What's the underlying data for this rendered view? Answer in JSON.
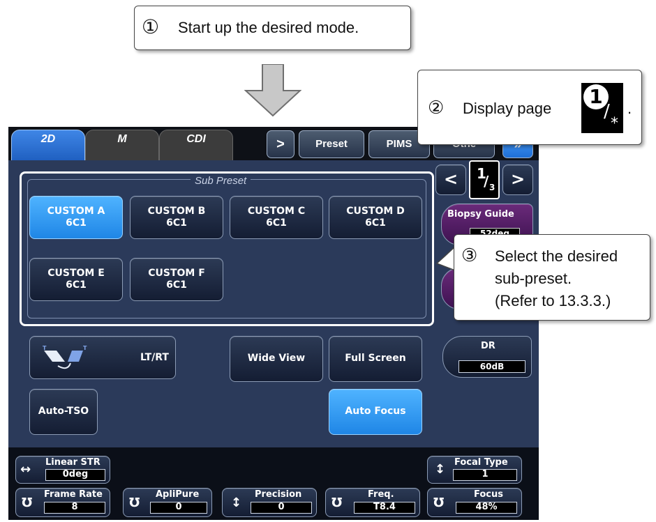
{
  "callouts": {
    "step1_num": "①",
    "step1_text": "Start up the desired mode.",
    "step2_num": "②",
    "step2_text": "Display page",
    "step2_period": ".",
    "step2_page_icon_num": "1",
    "step2_page_icon_sub": "*",
    "step3_num": "③",
    "step3_line1": "Select the desired",
    "step3_line2": "sub-preset.",
    "step3_line3": "(Refer to 13.3.3.)"
  },
  "tabs": [
    {
      "label": "2D",
      "active": true
    },
    {
      "label": "M",
      "active": false
    },
    {
      "label": "CDI",
      "active": false
    }
  ],
  "top_buttons": {
    "next_arrow": ">",
    "preset": "Preset",
    "pims": "PIMS",
    "other": "Othe",
    "more": "»"
  },
  "pager": {
    "prev": "<",
    "page": "1",
    "total": "3",
    "next": ">"
  },
  "sub_preset": {
    "title": "Sub Preset",
    "buttons": [
      {
        "name": "CUSTOM A",
        "probe": "6C1",
        "selected": true
      },
      {
        "name": "CUSTOM B",
        "probe": "6C1",
        "selected": false
      },
      {
        "name": "CUSTOM C",
        "probe": "6C1",
        "selected": false
      },
      {
        "name": "CUSTOM D",
        "probe": "6C1",
        "selected": false
      },
      {
        "name": "CUSTOM E",
        "probe": "6C1",
        "selected": false
      },
      {
        "name": "CUSTOM F",
        "probe": "6C1",
        "selected": false
      }
    ]
  },
  "side": {
    "biopsy_label": "Biopsy Guide",
    "biopsy_value": "52deg",
    "dr_label": "DR",
    "dr_value": "60dB"
  },
  "controls": {
    "ltrt": "LT/RT",
    "wide_view": "Wide View",
    "full_screen": "Full Screen",
    "auto_tso": "Auto-TSO",
    "auto_focus": "Auto Focus"
  },
  "bottom": {
    "linear_str_label": "Linear STR",
    "linear_str_value": "0deg",
    "focal_type_label": "Focal Type",
    "focal_type_value": "1",
    "frame_rate_label": "Frame Rate",
    "frame_rate_value": "8",
    "aplipure_label": "ApliPure",
    "aplipure_value": "0",
    "precision_label": "Precision",
    "precision_value": "0",
    "freq_label": "Freq.",
    "freq_value": "T8.4",
    "focus_label": "Focus",
    "focus_value": "48%"
  },
  "colors": {
    "panel": "#2b3a5a",
    "selected": "#2a95f0",
    "tab_active": "#2a6fd0",
    "tab_inactive": "#3a3a3a"
  }
}
